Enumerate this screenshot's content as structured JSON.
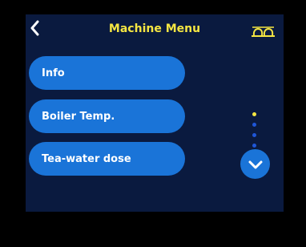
{
  "header": {
    "title": "Machine Menu",
    "back_icon": "chevron-left-icon",
    "coffee_icon": "coffee-cups-icon"
  },
  "menu": {
    "items": [
      {
        "label": "Info"
      },
      {
        "label": "Boiler Temp."
      },
      {
        "label": "Tea-water dose"
      }
    ]
  },
  "pagination": {
    "total": 4,
    "active_index": 0
  },
  "colors": {
    "screen_bg": "#0a1a3f",
    "accent_yellow": "#f5e642",
    "button_blue": "#1a74d8",
    "inactive_dot": "#1f56d8"
  }
}
